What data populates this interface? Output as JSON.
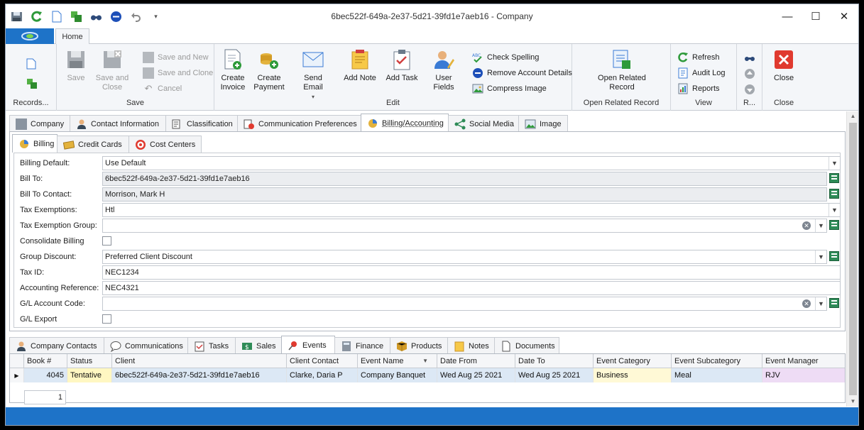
{
  "window": {
    "title": "6bec522f-649a-2e37-5d21-39fd1e7aeb16 - Company",
    "controls": {
      "minimize": "—",
      "maximize": "☐",
      "close": "✕"
    }
  },
  "quick_access": [
    "save-icon",
    "refresh-icon",
    "new-icon",
    "add-icon",
    "binoculars-icon",
    "remove-icon",
    "undo-icon",
    "customize-icon"
  ],
  "ribbon_tabs": {
    "home": "Home"
  },
  "ribbon": {
    "records": {
      "label": "Records..."
    },
    "save": {
      "save": "Save",
      "save_and_close": "Save and Close",
      "save_and_new": "Save and New",
      "save_and_clone": "Save and Clone",
      "cancel": "Cancel",
      "label": "Save"
    },
    "edit": {
      "create_invoice": "Create Invoice",
      "create_payment": "Create Payment",
      "send_email": "Send Email",
      "add_note": "Add Note",
      "add_task": "Add Task",
      "user_fields": "User Fields",
      "check_spelling": "Check Spelling",
      "remove_account_details": "Remove Account Details",
      "compress_image": "Compress Image",
      "label": "Edit"
    },
    "open_related": {
      "button": "Open Related Record",
      "label": "Open Related Record"
    },
    "view": {
      "refresh": "Refresh",
      "audit_log": "Audit Log",
      "reports": "Reports",
      "label": "View"
    },
    "r": {
      "label": "R..."
    },
    "close": {
      "button": "Close",
      "label": "Close"
    }
  },
  "main_tabs": [
    "Company",
    "Contact Information",
    "Classification",
    "Communication Preferences",
    "Billing/Accounting",
    "Social Media",
    "Image"
  ],
  "sub_tabs": [
    "Billing",
    "Credit Cards",
    "Cost Centers"
  ],
  "form": {
    "billing_default": {
      "label": "Billing Default:",
      "value": "Use Default"
    },
    "bill_to": {
      "label": "Bill To:",
      "value": "6bec522f-649a-2e37-5d21-39fd1e7aeb16"
    },
    "bill_to_contact": {
      "label": "Bill To Contact:",
      "value": "Morrison, Mark H"
    },
    "tax_exemptions": {
      "label": "Tax Exemptions:",
      "value": "Htl"
    },
    "tax_exemption_group": {
      "label": "Tax Exemption Group:",
      "value": ""
    },
    "consolidate_billing": {
      "label": "Consolidate Billing",
      "checked": false
    },
    "group_discount": {
      "label": "Group Discount:",
      "value": "Preferred Client Discount"
    },
    "tax_id": {
      "label": "Tax ID:",
      "value": "NEC1234"
    },
    "accounting_reference": {
      "label": "Accounting Reference:",
      "value": "NEC4321"
    },
    "gl_account_code": {
      "label": "G/L Account Code:",
      "value": ""
    },
    "gl_export": {
      "label": "G/L Export",
      "checked": false
    }
  },
  "bottom_tabs": [
    "Company Contacts",
    "Communications",
    "Tasks",
    "Sales",
    "Events",
    "Finance",
    "Products",
    "Notes",
    "Documents"
  ],
  "grid": {
    "columns": [
      "Book #",
      "Status",
      "Client",
      "Client Contact",
      "Event Name",
      "Date From",
      "Date To",
      "Event Category",
      "Event Subcategory",
      "Event Manager"
    ],
    "rows": [
      [
        "4045",
        "Tentative",
        "6bec522f-649a-2e37-5d21-39fd1e7aeb16",
        "Clarke, Daria P",
        "Company Banquet",
        "Wed Aug 25 2021",
        "Wed Aug 25 2021",
        "Business",
        "Meal",
        "RJV"
      ]
    ],
    "page": "1"
  },
  "colors": {
    "accent": "#1e73c8",
    "tentative": "#fff7c2",
    "business": "#fff9d6",
    "manager": "#eedcf5",
    "row": "#dce8f5"
  }
}
